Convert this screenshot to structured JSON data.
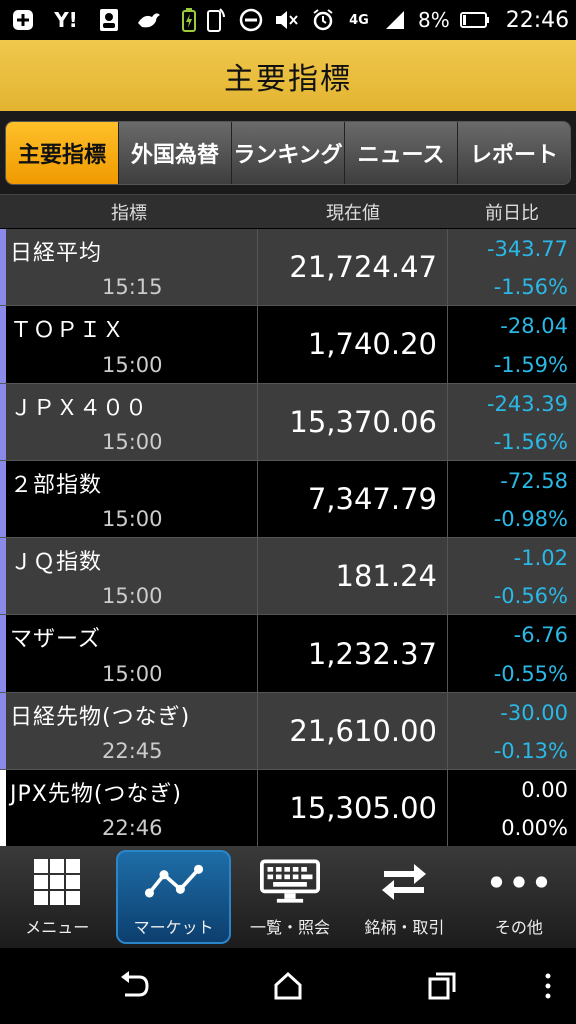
{
  "status_bar": {
    "left_icons": [
      "add-box-icon",
      "yahoo-icon",
      "contacts-icon",
      "bird-icon",
      "battery-saver-icon"
    ],
    "battery_percent": "8%",
    "network": "4G",
    "time": "22:46"
  },
  "title": "主要指標",
  "tabs": [
    {
      "label": "主要指標",
      "active": true
    },
    {
      "label": "外国為替",
      "active": false
    },
    {
      "label": "ランキング",
      "active": false
    },
    {
      "label": "ニュース",
      "active": false
    },
    {
      "label": "レポート",
      "active": false
    }
  ],
  "columns": {
    "name": "指標",
    "value": "現在値",
    "change": "前日比"
  },
  "rows": [
    {
      "name": "日経平均",
      "time": "15:15",
      "value": "21,724.47",
      "change": "-343.77",
      "change_pct": "-1.56%"
    },
    {
      "name": "ＴＯＰＩＸ",
      "time": "15:00",
      "value": "1,740.20",
      "change": "-28.04",
      "change_pct": "-1.59%"
    },
    {
      "name": "ＪＰＸ４００",
      "time": "15:00",
      "value": "15,370.06",
      "change": "-243.39",
      "change_pct": "-1.56%"
    },
    {
      "name": "２部指数",
      "time": "15:00",
      "value": "7,347.79",
      "change": "-72.58",
      "change_pct": "-0.98%"
    },
    {
      "name": "ＪＱ指数",
      "time": "15:00",
      "value": "181.24",
      "change": "-1.02",
      "change_pct": "-0.56%"
    },
    {
      "name": "マザーズ",
      "time": "15:00",
      "value": "1,232.37",
      "change": "-6.76",
      "change_pct": "-0.55%"
    },
    {
      "name": "日経先物(つなぎ)",
      "time": "22:45",
      "value": "21,610.00",
      "change": "-30.00",
      "change_pct": "-0.13%"
    },
    {
      "name": "JPX先物(つなぎ)",
      "time": "22:46",
      "value": "15,305.00",
      "change": "0.00",
      "change_pct": "0.00%"
    }
  ],
  "bottom_nav": [
    {
      "label": "メニュー",
      "icon": "grid-icon",
      "active": false
    },
    {
      "label": "マーケット",
      "icon": "line-chart-icon",
      "active": true
    },
    {
      "label": "一覧・照会",
      "icon": "keyboard-monitor-icon",
      "active": false
    },
    {
      "label": "銘柄・取引",
      "icon": "swap-arrows-icon",
      "active": false
    },
    {
      "label": "その他",
      "icon": "more-dots-icon",
      "active": false
    }
  ],
  "colors": {
    "title_bar": "#e8bd3c",
    "active_tab": "#f5a800",
    "negative": "#2ab8e6",
    "accent_strip": "#8a8ae8",
    "active_nav": "#1e6ea8"
  }
}
